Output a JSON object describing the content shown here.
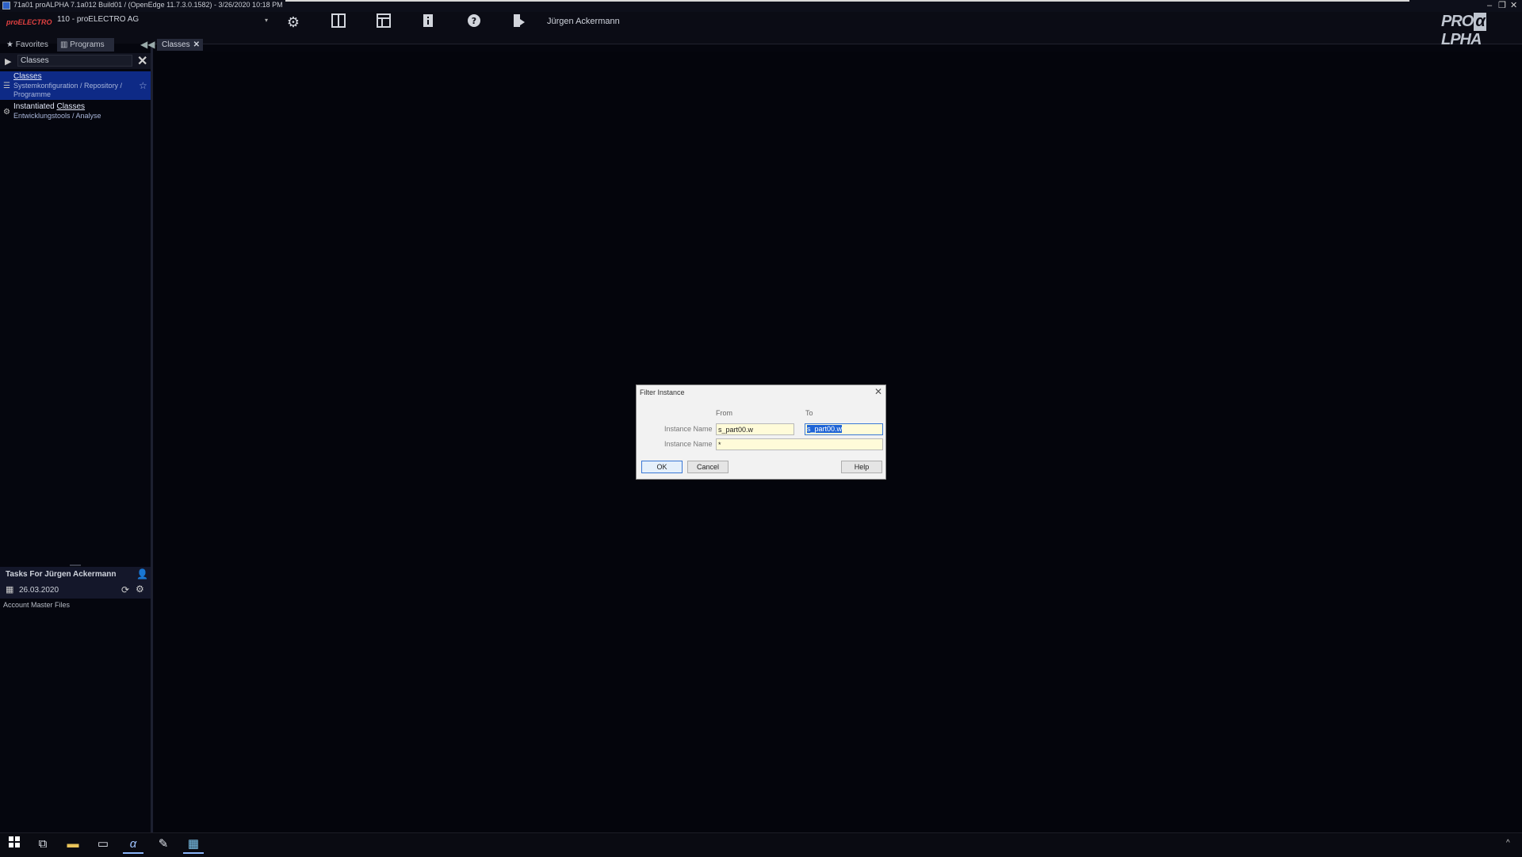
{
  "window": {
    "title": "71a01 proALPHA 7.1a012 Build01 / (OpenEdge 11.7.3.0.1582) - 3/26/2020 10:18 PM",
    "minimize": "–",
    "restore": "❐",
    "close": "✕"
  },
  "toolbar": {
    "brand": "proELECTRO",
    "company": "110 - proELECTRO AG",
    "user": "Jürgen Ackermann",
    "logo_left": "PRO",
    "logo_mid": "α",
    "logo_right": "LPHA",
    "icons": [
      "gear-icon",
      "columns-icon",
      "layout-icon",
      "info-icon",
      "help-icon",
      "logout-icon"
    ]
  },
  "nav": {
    "tabs": [
      {
        "label": "Favorites",
        "icon": "star-icon"
      },
      {
        "label": "Programs",
        "icon": "programs-icon"
      }
    ],
    "search_value": "Classes",
    "results": [
      {
        "title": "Classes",
        "path": "Systemkonfiguration / Repository / Programme"
      },
      {
        "title_prefix": "Instantiated ",
        "title_match": "Classes",
        "path": "Entwicklungstools / Analyse"
      }
    ]
  },
  "tasks": {
    "title": "Tasks For Jürgen Ackermann",
    "date": "26.03.2020",
    "items": [
      "Account Master Files"
    ]
  },
  "main": {
    "tabs": [
      {
        "label": "Classes"
      }
    ]
  },
  "dialog": {
    "title": "Filter Instance",
    "col_from": "From",
    "col_to": "To",
    "row1_label": "Instance Name",
    "row2_label": "Instance Name",
    "from_name": "s_part00.w",
    "to_name": "s_part00.w",
    "from_name2": "*",
    "ok": "OK",
    "cancel": "Cancel",
    "help": "Help"
  }
}
